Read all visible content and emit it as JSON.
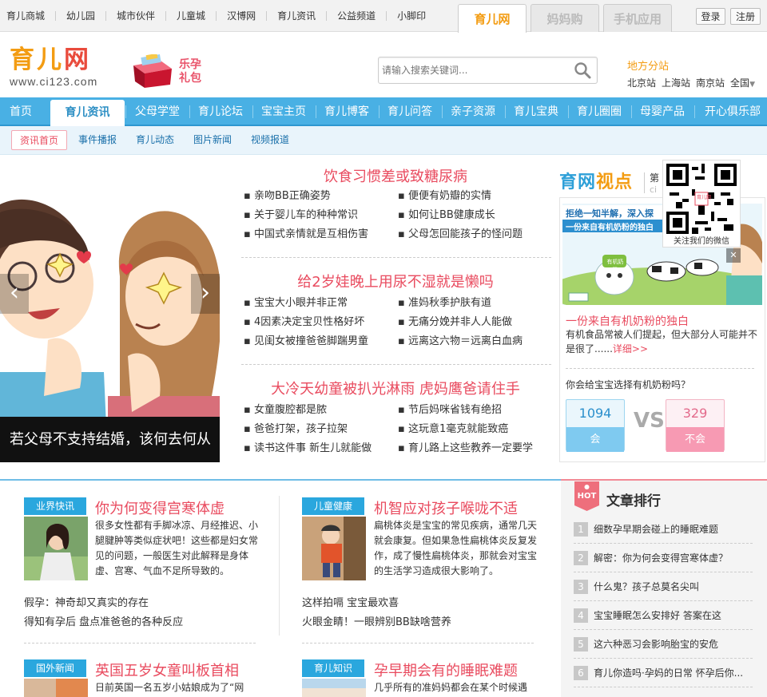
{
  "top_links": [
    "育儿商城",
    "幼儿园",
    "城市伙伴",
    "儿童城",
    "汉博网",
    "育儿资讯",
    "公益频道",
    "小脚印"
  ],
  "top_tabs": [
    "育儿网",
    "妈妈购",
    "手机应用"
  ],
  "auth": {
    "login": "登录",
    "register": "注册"
  },
  "logo": {
    "name_a": "育儿",
    "name_b": "网",
    "domain": "www.ci123.com"
  },
  "gift": {
    "line1": "乐孕",
    "line2": "礼包"
  },
  "search": {
    "placeholder": "请输入搜索关键词..."
  },
  "cities": {
    "title": "地方分站",
    "items": [
      "北京站",
      "上海站",
      "南京站"
    ],
    "all": "全国"
  },
  "main_nav": {
    "home": "首页",
    "active": "育儿资讯",
    "items": [
      "父母学堂",
      "育儿论坛",
      "宝宝主页",
      "育儿博客",
      "育儿问答",
      "亲子资源",
      "育儿宝典",
      "育儿圈圈",
      "母婴产品",
      "开心俱乐部"
    ]
  },
  "sub_nav": [
    "资讯首页",
    "事件播报",
    "育儿动态",
    "图片新闻",
    "视频报道"
  ],
  "slider": {
    "caption": "若父母不支持结婚，该何去何从"
  },
  "news_blocks": [
    {
      "headline": "饮食习惯差或致糖尿病",
      "items": [
        "亲吻BB正确姿势",
        "便便有奶瓣的实情",
        "关于婴儿车的种种常识",
        "如何让BB健康成长",
        "中国式亲情就是互相伤害",
        "父母怎回能孩子的怪问题"
      ]
    },
    {
      "headline": "给2岁娃晚上用尿不湿就是懒吗",
      "items": [
        "宝宝大小眼并非正常",
        "准妈秋季护肤有道",
        "4因素决定宝贝性格好坏",
        "无痛分娩并非人人能做",
        "见闺女被撞爸爸脚踹男童",
        "远离这六物＝远离白血病"
      ]
    },
    {
      "headline": "大冷天幼童被扒光淋雨 虎妈鹰爸请住手",
      "items": [
        "女童腹腔都是脓",
        "节后妈咪省钱有绝招",
        "爸爸打架，孩子拉架",
        "这玩意1毫克就能致癌",
        "读书这件事 新生儿就能做",
        "育儿路上这些教养一定要学"
      ]
    }
  ],
  "viewpoint": {
    "logo_a": "育网",
    "logo_b": "视点",
    "issue_partial": "第",
    "latin_partial": "ci",
    "qr_caption": "关注我们的微信",
    "qr_mini": "育儿网"
  },
  "promo": {
    "banner_line1": "拒绝一知半解，深入探",
    "banner_line2": "一份来自有机奶粉的独白",
    "title": "一份来自有机奶粉的独白",
    "desc": "有机食品常被人们提起，但大部分人可能并不是很了......",
    "more": "详细>>",
    "close": "✕",
    "badge": "有机奶粉"
  },
  "vote": {
    "question": "你会给宝宝选择有机奶粉吗？",
    "yes_count": "1094",
    "yes_label": "会",
    "no_count": "329",
    "no_label": "不会",
    "vs": "VS"
  },
  "articles": [
    {
      "tag": "业界快讯",
      "title": "你为何变得宫寒体虚",
      "desc": "很多女性都有手脚冰凉、月经推迟、小腿腱肿等类似症状吧！这些都是妇女常见的问题，一般医生对此解释是身体虚、宫寒、气血不足所导致的。",
      "links": [
        "假孕：神奇却又真实的存在",
        "得知有孕后 盘点准爸爸的各种反应"
      ]
    },
    {
      "tag": "儿童健康",
      "title": "机智应对孩子喉咙不适",
      "desc": "扁桃体炎是宝宝的常见疾病，通常几天就会康复。但如果急性扁桃体炎反复发作，成了慢性扁桃体炎，那就会对宝宝的生活学习造成很大影响了。",
      "links": [
        "这样拍嗝 宝宝最欢喜",
        "火眼金睛！一眼辨别BB缺啥营养"
      ]
    },
    {
      "tag": "国外新闻",
      "title": "英国五岁女童叫板首相",
      "desc": "日前英国一名五岁小姑娘成为了“网",
      "links": []
    },
    {
      "tag": "育儿知识",
      "title": "孕早期会有的睡眠难题",
      "desc": "几乎所有的准妈妈都会在某个时候遇",
      "links": []
    }
  ],
  "ranking": {
    "hot_label": "HOT",
    "title": "文章排行",
    "items": [
      "细数孕早期会碰上的睡眠难题",
      "解密：你为何会变得宫寒体虚？",
      "什么鬼？孩子总莫名尖叫",
      "宝宝睡眠怎么安排好 答案在这",
      "这六种恶习会影响胎宝的安危",
      "育儿你造吗·孕妈的日常 怀孕后你..."
    ]
  },
  "colors": {
    "brand_orange": "#f39c12",
    "nav_blue": "#49b0e4",
    "headline_pink": "#e94b5f",
    "tag_blue": "#2aa7de"
  }
}
